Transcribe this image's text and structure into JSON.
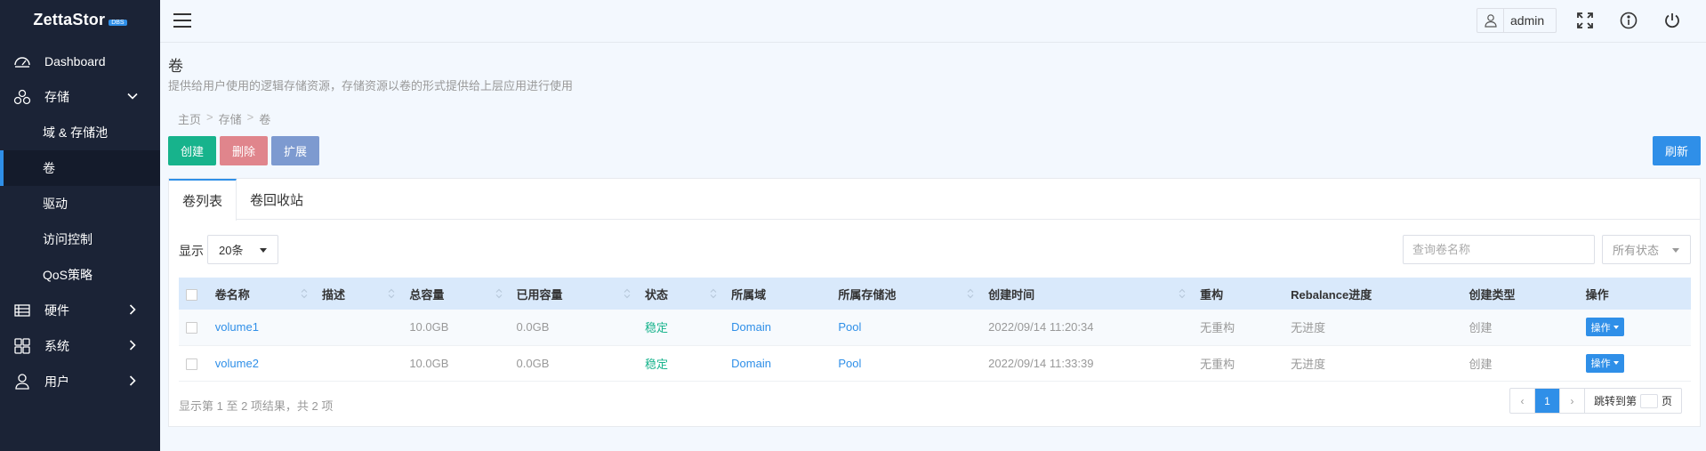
{
  "app": {
    "logo": "ZettaStor",
    "badge": "DBS"
  },
  "sidebar": {
    "items": [
      {
        "label": "Dashboard",
        "icon": "dashboard-icon"
      },
      {
        "label": "存储",
        "icon": "storage-icon"
      },
      {
        "label": "硬件",
        "icon": "hardware-icon"
      },
      {
        "label": "系统",
        "icon": "system-icon"
      },
      {
        "label": "用户",
        "icon": "user-icon"
      }
    ],
    "storage_sub": [
      "域 & 存储池",
      "卷",
      "驱动",
      "访问控制",
      "QoS策略"
    ]
  },
  "header": {
    "username": "admin"
  },
  "page": {
    "title": "卷",
    "description": "提供给用户使用的逻辑存储资源，存储资源以卷的形式提供给上层应用进行使用",
    "breadcrumb": [
      "主页",
      "存储",
      "卷"
    ]
  },
  "toolbar": {
    "create": "创建",
    "delete": "删除",
    "expand": "扩展",
    "refresh": "刷新"
  },
  "tabs": [
    "卷列表",
    "卷回收站"
  ],
  "filters": {
    "show_label": "显示",
    "page_size": "20条",
    "search_placeholder": "查询卷名称",
    "status": "所有状态"
  },
  "table": {
    "columns": [
      "卷名称",
      "描述",
      "总容量",
      "已用容量",
      "状态",
      "所属域",
      "所属存储池",
      "创建时间",
      "重构",
      "Rebalance进度",
      "创建类型",
      "操作"
    ],
    "rows": [
      {
        "name": "volume1",
        "desc": "",
        "total": "10.0GB",
        "used": "0.0GB",
        "status": "稳定",
        "domain": "Domain",
        "pool": "Pool",
        "created": "2022/09/14 11:20:34",
        "rebuild": "无重构",
        "rebalance": "无进度",
        "type": "创建",
        "op": "操作"
      },
      {
        "name": "volume2",
        "desc": "",
        "total": "10.0GB",
        "used": "0.0GB",
        "status": "稳定",
        "domain": "Domain",
        "pool": "Pool",
        "created": "2022/09/14 11:33:39",
        "rebuild": "无重构",
        "rebalance": "无进度",
        "type": "创建",
        "op": "操作"
      }
    ]
  },
  "footer": {
    "info": "显示第 1 至 2 项结果，共 2 项",
    "prev": "‹",
    "current_page": "1",
    "next": "›",
    "jump_label": "跳转到第",
    "jump_suffix": "页"
  },
  "colors": {
    "sidebar_bg": "#1b2336",
    "accent": "#2f8fe8",
    "create": "#17b38c",
    "delete": "#e0858c",
    "expand": "#7d9ad0"
  }
}
